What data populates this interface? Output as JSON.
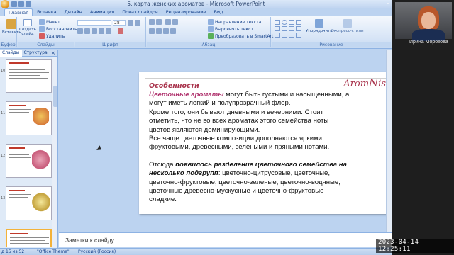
{
  "window": {
    "title": "5. карта женских ароматов - Microsoft PowerPoint"
  },
  "ribbon": {
    "tabs": [
      "Главная",
      "Вставка",
      "Дизайн",
      "Анимация",
      "Показ слайдов",
      "Рецензирование",
      "Вид"
    ],
    "active_tab": "Главная",
    "clipboard": {
      "paste": "Вставить",
      "label": "Буфер ..."
    },
    "slides": {
      "new_slide": "Создать слайд",
      "layout": "Макет",
      "restore": "Восстановить",
      "delete": "Удалить",
      "label": "Слайды"
    },
    "font": {
      "label": "Шрифт",
      "font_size": "28"
    },
    "paragraph": {
      "label": "Абзац",
      "text_direction": "Направление текста",
      "align_text": "Выровнять текст",
      "convert_smartart": "Преобразовать в SmartArt"
    },
    "drawing": {
      "arrange": "Упорядочить",
      "quick_styles": "Экспресс-стили",
      "label": "Рисование"
    }
  },
  "left_panel": {
    "tabs": [
      "Слайды",
      "Структура"
    ],
    "active_tab": "Слайды",
    "slide_numbers": [
      "10",
      "11",
      "12",
      "13"
    ]
  },
  "slide": {
    "logo": {
      "prefix": "Arom",
      "letter": "N",
      "suffix": "is"
    },
    "heading": "Особенности",
    "lines": [
      {
        "accent": "Цветочные ароматы",
        "text": " могут быть густыми и насыщенными, а"
      },
      {
        "text": "могут иметь легкий и полупрозрачный флер."
      },
      {
        "text": "Кроме того, они бывают дневными и вечерними. Стоит"
      },
      {
        "text": "отметить, что не во всех ароматах этого семейства ноты"
      },
      {
        "text": "цветов являются доминирующими."
      },
      {
        "text": " Все чаще цветочные композиции дополняются яркими"
      },
      {
        "text": "фруктовыми, древесными, зелеными и пряными нотами."
      }
    ],
    "para2_lead": "Отсюда ",
    "para2_emph_1": "появилось разделение цветочного семейства на",
    "para2_emph_2": "несколько подгрупп",
    "para2_lines": [
      ": цветочно-цитрусовые, цветочные,",
      "цветочно-фруктовые, цветочно-зеленые, цветочно-водяные,",
      "цветочные древесно-мускусные и цветочно-фруктовые",
      "сладкие."
    ]
  },
  "notes": {
    "placeholder": "Заметки к слайду"
  },
  "status": {
    "slide_counter": "д 15 из 52",
    "theme": "\"Office Theme\"",
    "language": "Русский (Россия)"
  },
  "webcam": {
    "name": "Ирина Морозова"
  },
  "timestamp": "2023-04-14  12:25:11"
}
